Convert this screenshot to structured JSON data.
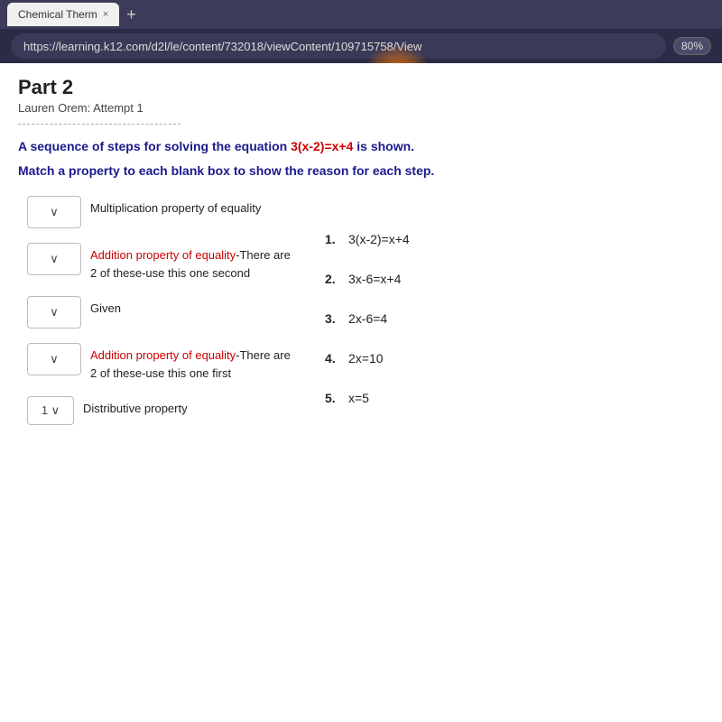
{
  "browser": {
    "tab_title": "Chemical Therm",
    "tab_close": "×",
    "new_tab": "+",
    "address": "https://learning.k12.com/d2l/le/content/732018/viewContent/109715758/View",
    "zoom": "80%"
  },
  "page": {
    "title": "Part 2",
    "subtitle": "Lauren Orem: Attempt 1"
  },
  "question": {
    "text_before": "A sequence of steps for solving the equation ",
    "equation": "3(x-2)=x+4",
    "text_after": " is shown.",
    "instruction": "Match a property to each blank box to show the reason for each step."
  },
  "left_items": [
    {
      "dropdown_value": "∨",
      "property": "Multiplication property of equality",
      "property_class": "normal"
    },
    {
      "dropdown_value": "∨",
      "property": "Addition property of equality",
      "property_suffix": "-There are 2 of these-use this one second",
      "property_class": "red"
    },
    {
      "dropdown_value": "∨",
      "property": "Given",
      "property_class": "normal"
    },
    {
      "dropdown_value": "∨",
      "property": "Addition property of equality",
      "property_suffix": "-There are 2 of these-use this one first",
      "property_class": "red"
    },
    {
      "dropdown_value": "1 ∨",
      "property": "Distributive property",
      "property_class": "normal"
    }
  ],
  "right_items": [
    {
      "number": "1.",
      "equation": "3(x-2)=x+4"
    },
    {
      "number": "2.",
      "equation": "3x-6=x+4"
    },
    {
      "number": "3.",
      "equation": "2x-6=4"
    },
    {
      "number": "4.",
      "equation": "2x=10"
    },
    {
      "number": "5.",
      "equation": "x=5"
    }
  ]
}
